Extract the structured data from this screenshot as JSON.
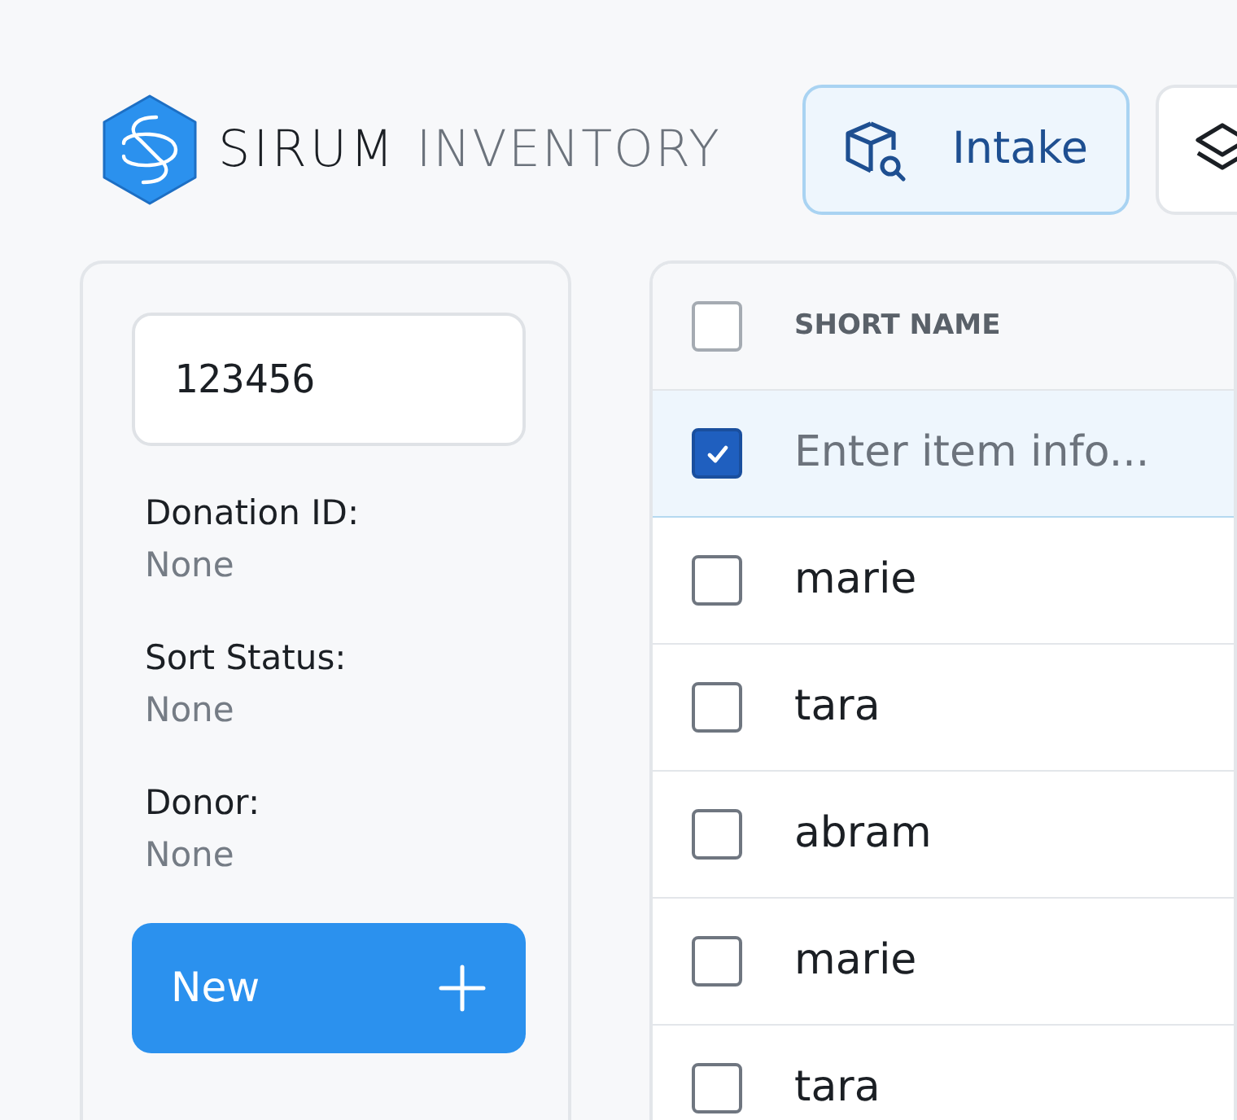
{
  "brand": {
    "name": "SIRUM",
    "product": "INVENTORY"
  },
  "nav": [
    {
      "label": "Intake",
      "selected": true
    },
    {
      "selected": false
    }
  ],
  "sidebar": {
    "search": {
      "value": "123456"
    },
    "fields": [
      {
        "label": "Donation ID:",
        "value": "None"
      },
      {
        "label": "Sort Status:",
        "value": "None"
      },
      {
        "label": "Donor:",
        "value": "None"
      }
    ],
    "new_button": "New"
  },
  "table": {
    "header": {
      "checked": false,
      "column": "SHORT NAME"
    },
    "entry_row": {
      "checked": true,
      "placeholder": "Enter item info..."
    },
    "rows": [
      {
        "checked": false,
        "short_name": "marie"
      },
      {
        "checked": false,
        "short_name": "tara"
      },
      {
        "checked": false,
        "short_name": "abram"
      },
      {
        "checked": false,
        "short_name": "marie"
      },
      {
        "checked": false,
        "short_name": "tara"
      }
    ]
  }
}
